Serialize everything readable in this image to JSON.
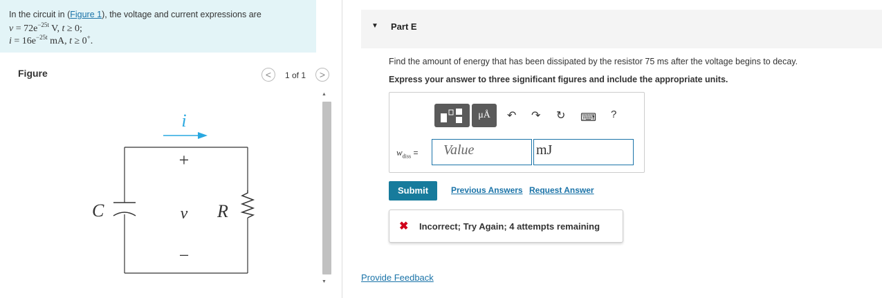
{
  "problem": {
    "intro": "In the circuit in (",
    "figure_link": "Figure 1",
    "intro_end": "), the voltage and current expressions are",
    "eq1": {
      "lhs": "v",
      "mid": " = 72e",
      "exp": "−25t",
      "unit": " V,   ",
      "cond": "t",
      "cond2": " ≥ 0;"
    },
    "eq2": {
      "lhs": "i",
      "mid": " = 16e",
      "exp": "−25t",
      "unit": " mA,   ",
      "cond": "t",
      "cond2": " ≥ 0",
      "sup": "+",
      "end": "."
    }
  },
  "figure": {
    "title": "Figure",
    "counter": "1 of 1",
    "prev": "<",
    "next": ">",
    "labels": {
      "current": "i",
      "plus": "+",
      "voltage": "v",
      "minus": "−",
      "capacitor": "C",
      "resistor": "R"
    }
  },
  "part": {
    "caret": "▼",
    "title": "Part E",
    "question": "Find the amount of energy that has been dissipated by the resistor 75 ms after the voltage begins to decay.",
    "instruction": "Express your answer to three significant figures and include the appropriate units."
  },
  "toolbar": {
    "units_label": "μÅ",
    "undo": "↶",
    "redo": "↷",
    "reset": "↻",
    "keyboard": "⌨",
    "help": "?"
  },
  "answer": {
    "var": "w",
    "var_sub": "diss",
    "equals": " =",
    "value_placeholder": "Value",
    "unit_value": "mJ"
  },
  "actions": {
    "submit": "Submit",
    "previous_answers": "Previous Answers",
    "request_answer": "Request Answer"
  },
  "feedback": {
    "icon": "✖",
    "text": "Incorrect; Try Again; 4 attempts remaining"
  },
  "footer": {
    "provide_feedback": "Provide Feedback"
  },
  "colors": {
    "accent": "#177b9c",
    "link": "#1a73a8",
    "error": "#d0021b",
    "figure_arrow": "#29a8e0"
  }
}
